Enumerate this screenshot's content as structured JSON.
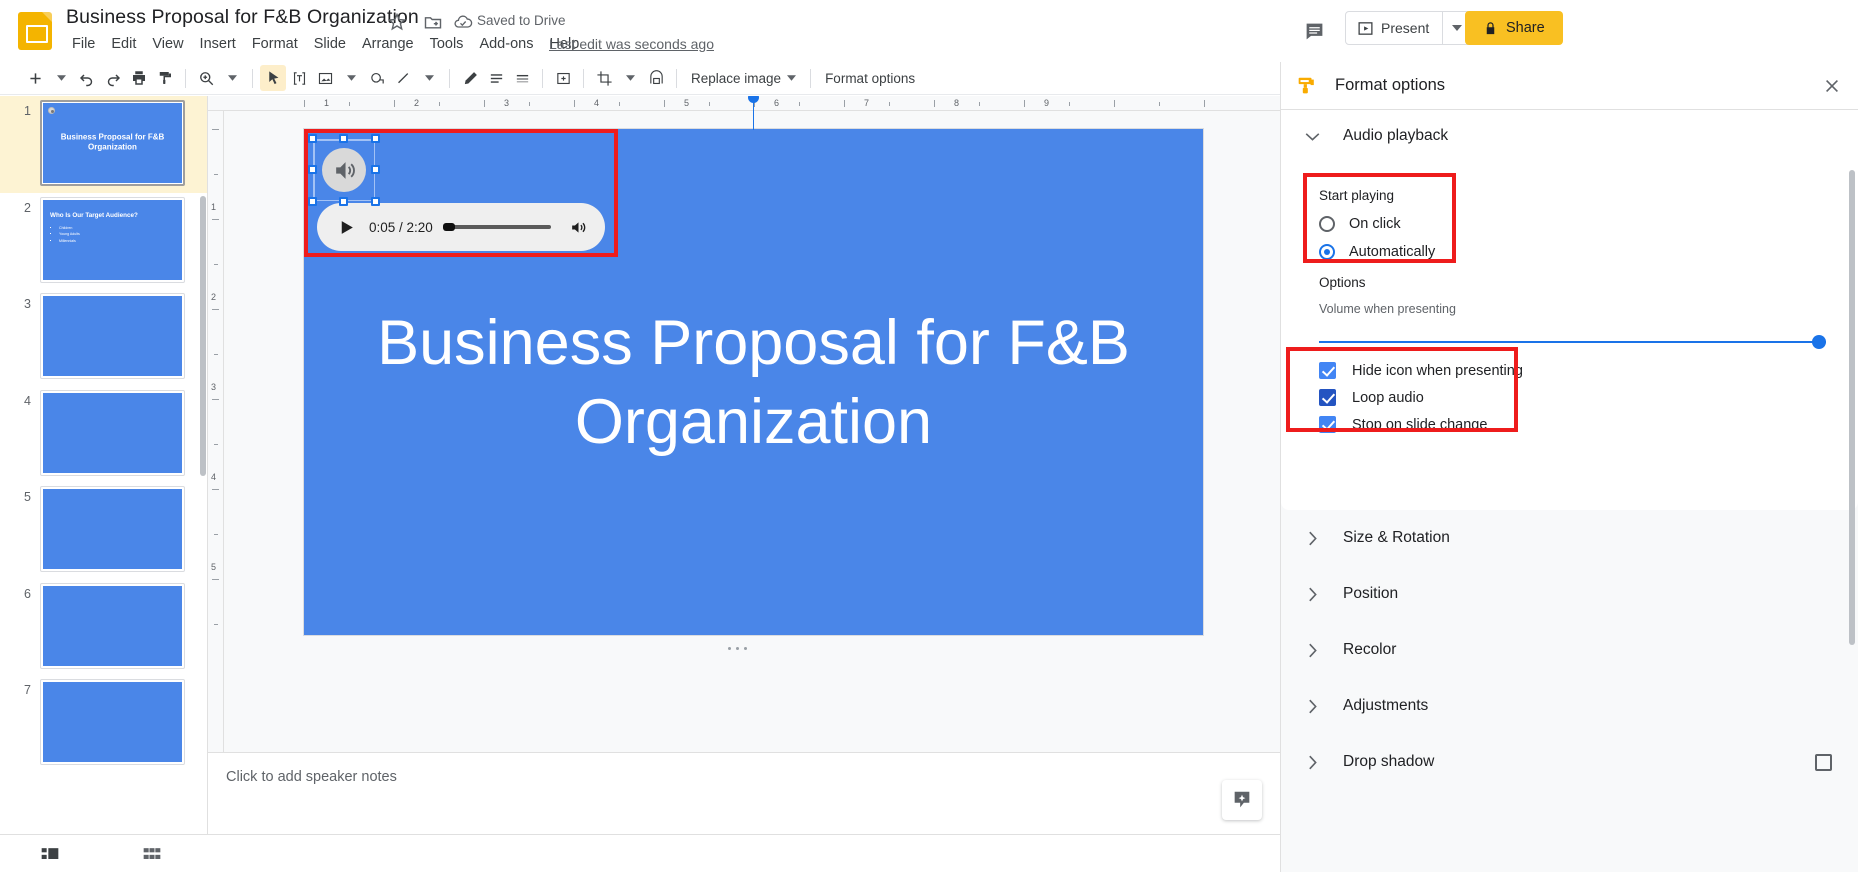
{
  "header": {
    "doc_title": "Business Proposal for F&B Organization",
    "save_status": "Saved to Drive",
    "last_edit": "Last edit was seconds ago",
    "menus": [
      "File",
      "Edit",
      "View",
      "Insert",
      "Format",
      "Slide",
      "Arrange",
      "Tools",
      "Add-ons",
      "Help"
    ],
    "present_label": "Present",
    "share_label": "Share"
  },
  "toolbar": {
    "replace_image_label": "Replace image",
    "format_options_label": "Format options"
  },
  "filmstrip": {
    "slides": [
      {
        "num": "1",
        "title": "Business Proposal for F&B Organization",
        "type": "title",
        "selected": true,
        "has_audio": true
      },
      {
        "num": "2",
        "title": "Who Is Our Target Audience?",
        "type": "bullets",
        "bullets": [
          "Children",
          "Young Adults",
          "Millennials"
        ],
        "selected": false,
        "has_audio": false
      },
      {
        "num": "3",
        "title": "",
        "type": "blank",
        "selected": false,
        "has_audio": false
      },
      {
        "num": "4",
        "title": "",
        "type": "blank",
        "selected": false,
        "has_audio": false
      },
      {
        "num": "5",
        "title": "",
        "type": "blank",
        "selected": false,
        "has_audio": false
      },
      {
        "num": "6",
        "title": "",
        "type": "blank",
        "selected": false,
        "has_audio": false
      },
      {
        "num": "7",
        "title": "",
        "type": "blank",
        "selected": false,
        "has_audio": false
      }
    ]
  },
  "slide": {
    "title": "Business Proposal for F&B Organization",
    "background_color": "#4a86e8",
    "title_color": "#ffffff"
  },
  "audio_player": {
    "current_time": "0:05",
    "total_time": "2:20",
    "time_display": "0:05 / 2:20",
    "progress_percent": 4
  },
  "notes": {
    "placeholder": "Click to add speaker notes"
  },
  "panel": {
    "title": "Format options",
    "section_audio_playback": "Audio playback",
    "start_playing_label": "Start playing",
    "radio_on_click": "On click",
    "radio_automatically": "Automatically",
    "options_label": "Options",
    "volume_label": "Volume when presenting",
    "volume_value": 100,
    "checkbox_hide_icon": "Hide icon when presenting",
    "checkbox_loop_audio": "Loop audio",
    "checkbox_stop_on_slide_change": "Stop on slide change",
    "accordions": [
      {
        "label": "Size & Rotation",
        "has_checkbox": false
      },
      {
        "label": "Position",
        "has_checkbox": false
      },
      {
        "label": "Recolor",
        "has_checkbox": false
      },
      {
        "label": "Adjustments",
        "has_checkbox": false
      },
      {
        "label": "Drop shadow",
        "has_checkbox": true
      }
    ]
  },
  "ruler": {
    "h_ticks": [
      "1",
      "2",
      "3",
      "4",
      "5",
      "6",
      "7",
      "8",
      "9"
    ],
    "v_ticks": [
      "1",
      "2",
      "3",
      "4",
      "5"
    ]
  },
  "colors": {
    "accent_blue": "#1a73e8",
    "slide_blue": "#4a86e8",
    "annotation_red": "#ee1c1c",
    "share_yellow": "#F9C022"
  }
}
